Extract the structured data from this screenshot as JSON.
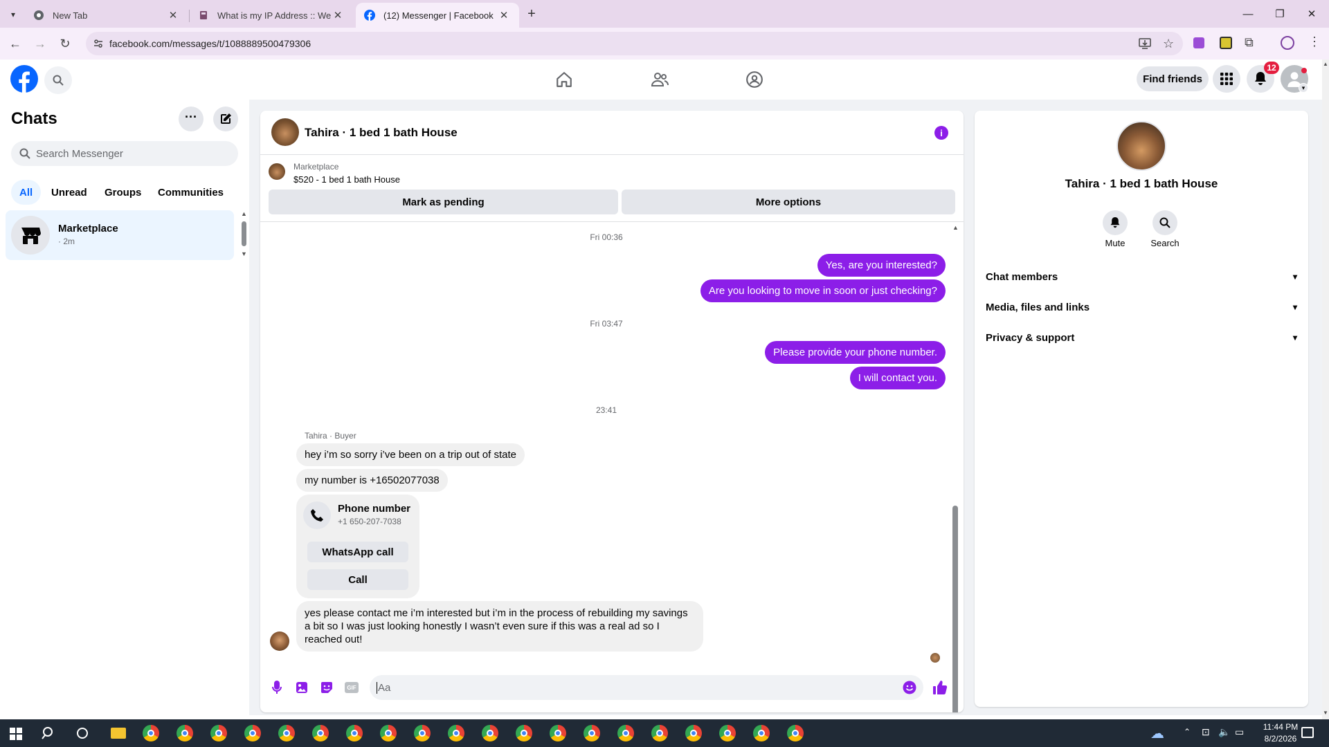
{
  "browser": {
    "tabs": [
      {
        "title": "New Tab"
      },
      {
        "title": "What is my IP Address :: WebBr"
      },
      {
        "title": "(12) Messenger | Facebook"
      }
    ],
    "url": "facebook.com/messages/t/1088889500479306"
  },
  "header": {
    "find_friends": "Find friends",
    "notification_count": "12"
  },
  "sidebar": {
    "title": "Chats",
    "search_placeholder": "Search Messenger",
    "filters": [
      "All",
      "Unread",
      "Groups",
      "Communities"
    ],
    "chats": [
      {
        "name": "Marketplace",
        "meta": "· 2m"
      }
    ]
  },
  "conversation": {
    "title": "Tahira · 1 bed 1 bath House",
    "marketplace_label": "Marketplace",
    "listing": "$520 - 1 bed 1 bath House",
    "mark_pending": "Mark as pending",
    "more_options": "More options",
    "timestamps": [
      "Fri 00:36",
      "Fri 03:47",
      "23:41"
    ],
    "outgoing": [
      "Yes, are you interested?",
      "Are you looking to move in soon or just checking?",
      "Please provide your phone number.",
      "I will contact you."
    ],
    "sender_label": "Tahira · Buyer",
    "incoming": [
      "hey i’m so sorry i’ve been on a trip out of state",
      "my number is +16502077038",
      "yes please contact me i’m interested but i’m in the process of rebuilding my savings a bit so I was just looking honestly I wasn’t even sure if this was a real ad so I reached out!"
    ],
    "phone_card": {
      "title": "Phone number",
      "number": "+1 650-207-7038",
      "whatsapp": "WhatsApp call",
      "call": "Call"
    },
    "composer_placeholder": "Aa"
  },
  "details": {
    "name": "Tahira · 1 bed 1 bath House",
    "mute": "Mute",
    "search": "Search",
    "sections": [
      "Chat members",
      "Media, files and links",
      "Privacy & support"
    ]
  },
  "taskbar": {
    "time": "11:44 PM",
    "date": "8/2/2026"
  },
  "colors": {
    "messenger_purple": "#8c1ee8",
    "facebook_blue": "#0866ff"
  }
}
